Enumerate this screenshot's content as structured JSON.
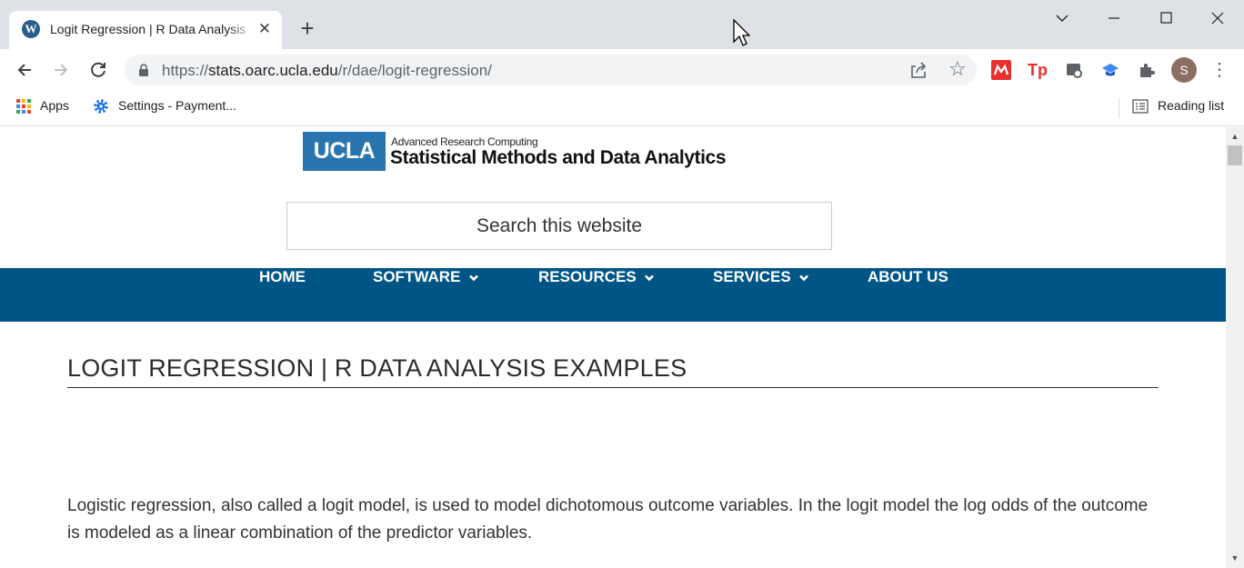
{
  "browser": {
    "tab": {
      "title": "Logit Regression | R Data Analysis Examples",
      "favicon": "wordpress-icon"
    },
    "url": {
      "scheme": "https://",
      "host": "stats.oarc.ucla.edu",
      "path": "/r/dae/logit-regression/"
    },
    "profile_initial": "S",
    "bookmarks": [
      {
        "label": "Apps",
        "icon": "apps-grid-icon"
      },
      {
        "label": "Settings - Payment...",
        "icon": "gear-icon"
      }
    ],
    "reading_list": "Reading list"
  },
  "site": {
    "logo": {
      "mark": "UCLA",
      "subtitle": "Advanced Research Computing",
      "title": "Statistical Methods and Data Analytics"
    },
    "search_placeholder": "Search this website",
    "nav": [
      {
        "label": "HOME",
        "dropdown": false
      },
      {
        "label": "SOFTWARE",
        "dropdown": true
      },
      {
        "label": "RESOURCES",
        "dropdown": true
      },
      {
        "label": "SERVICES",
        "dropdown": true
      },
      {
        "label": "ABOUT US",
        "dropdown": false
      }
    ]
  },
  "article": {
    "title": "LOGIT REGRESSION | R DATA ANALYSIS EXAMPLES",
    "intro": "Logistic regression, also called a logit model, is used to model dichotomous outcome variables. In the logit model the log odds of the outcome is modeled as a linear combination of the predictor variables."
  },
  "colors": {
    "nav_bar": "#005587",
    "ucla_blue": "#2774ae",
    "tab_strip": "#dee1e6"
  }
}
